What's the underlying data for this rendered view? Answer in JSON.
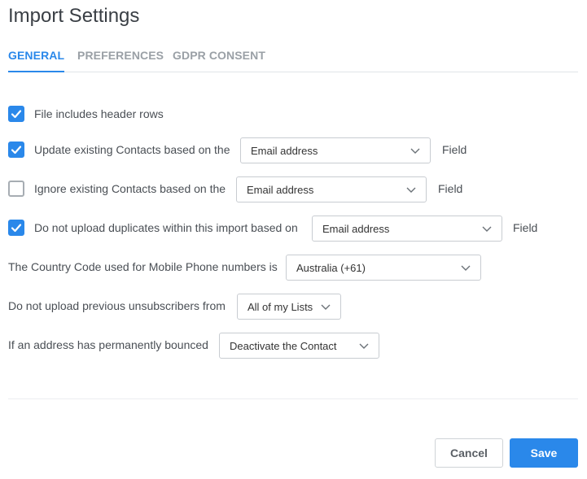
{
  "title": "Import Settings",
  "tabs": [
    {
      "label": "GENERAL",
      "active": true
    },
    {
      "label": "PREFERENCES",
      "active": false
    },
    {
      "label": "GDPR CONSENT",
      "active": false
    }
  ],
  "options": {
    "header_rows": {
      "checked": true,
      "label": "File includes header rows"
    },
    "update_existing": {
      "checked": true,
      "label": "Update existing Contacts based on the",
      "select": "Email address",
      "suffix": "Field"
    },
    "ignore_existing": {
      "checked": false,
      "label": "Ignore existing Contacts based on the",
      "select": "Email address",
      "suffix": "Field"
    },
    "no_duplicates": {
      "checked": true,
      "label": "Do not upload duplicates within this import based on",
      "select": "Email address",
      "suffix": "Field"
    }
  },
  "country_code": {
    "label": "The Country Code used for Mobile Phone numbers is",
    "select": "Australia (+61)"
  },
  "unsubscribers": {
    "label": "Do not upload previous unsubscribers from",
    "select": "All of my Lists"
  },
  "bounced": {
    "label": "If an address has permanently bounced",
    "select": "Deactivate the Contact"
  },
  "buttons": {
    "cancel": "Cancel",
    "save": "Save"
  },
  "colors": {
    "accent": "#2a88ea",
    "border": "#c8ccd1",
    "text": "#4a4f55"
  }
}
